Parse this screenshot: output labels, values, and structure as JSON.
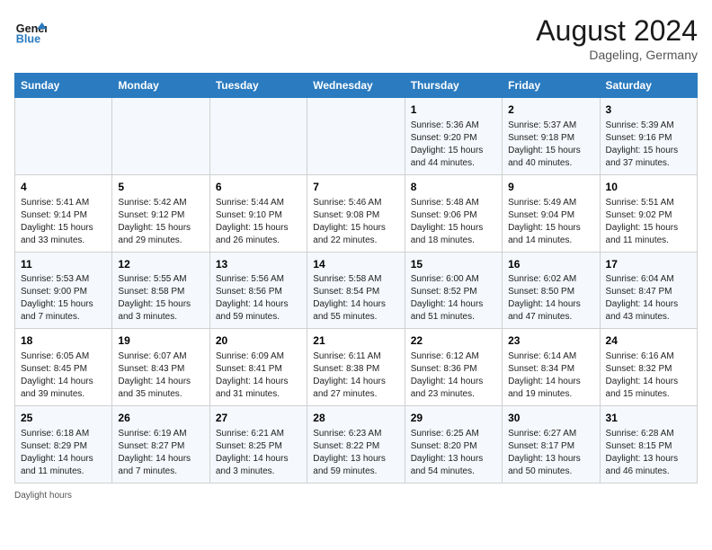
{
  "header": {
    "logo_line1": "General",
    "logo_line2": "Blue",
    "month_year": "August 2024",
    "location": "Dageling, Germany"
  },
  "days_of_week": [
    "Sunday",
    "Monday",
    "Tuesday",
    "Wednesday",
    "Thursday",
    "Friday",
    "Saturday"
  ],
  "weeks": [
    [
      {
        "day": "",
        "info": ""
      },
      {
        "day": "",
        "info": ""
      },
      {
        "day": "",
        "info": ""
      },
      {
        "day": "",
        "info": ""
      },
      {
        "day": "1",
        "info": "Sunrise: 5:36 AM\nSunset: 9:20 PM\nDaylight: 15 hours and 44 minutes."
      },
      {
        "day": "2",
        "info": "Sunrise: 5:37 AM\nSunset: 9:18 PM\nDaylight: 15 hours and 40 minutes."
      },
      {
        "day": "3",
        "info": "Sunrise: 5:39 AM\nSunset: 9:16 PM\nDaylight: 15 hours and 37 minutes."
      }
    ],
    [
      {
        "day": "4",
        "info": "Sunrise: 5:41 AM\nSunset: 9:14 PM\nDaylight: 15 hours and 33 minutes."
      },
      {
        "day": "5",
        "info": "Sunrise: 5:42 AM\nSunset: 9:12 PM\nDaylight: 15 hours and 29 minutes."
      },
      {
        "day": "6",
        "info": "Sunrise: 5:44 AM\nSunset: 9:10 PM\nDaylight: 15 hours and 26 minutes."
      },
      {
        "day": "7",
        "info": "Sunrise: 5:46 AM\nSunset: 9:08 PM\nDaylight: 15 hours and 22 minutes."
      },
      {
        "day": "8",
        "info": "Sunrise: 5:48 AM\nSunset: 9:06 PM\nDaylight: 15 hours and 18 minutes."
      },
      {
        "day": "9",
        "info": "Sunrise: 5:49 AM\nSunset: 9:04 PM\nDaylight: 15 hours and 14 minutes."
      },
      {
        "day": "10",
        "info": "Sunrise: 5:51 AM\nSunset: 9:02 PM\nDaylight: 15 hours and 11 minutes."
      }
    ],
    [
      {
        "day": "11",
        "info": "Sunrise: 5:53 AM\nSunset: 9:00 PM\nDaylight: 15 hours and 7 minutes."
      },
      {
        "day": "12",
        "info": "Sunrise: 5:55 AM\nSunset: 8:58 PM\nDaylight: 15 hours and 3 minutes."
      },
      {
        "day": "13",
        "info": "Sunrise: 5:56 AM\nSunset: 8:56 PM\nDaylight: 14 hours and 59 minutes."
      },
      {
        "day": "14",
        "info": "Sunrise: 5:58 AM\nSunset: 8:54 PM\nDaylight: 14 hours and 55 minutes."
      },
      {
        "day": "15",
        "info": "Sunrise: 6:00 AM\nSunset: 8:52 PM\nDaylight: 14 hours and 51 minutes."
      },
      {
        "day": "16",
        "info": "Sunrise: 6:02 AM\nSunset: 8:50 PM\nDaylight: 14 hours and 47 minutes."
      },
      {
        "day": "17",
        "info": "Sunrise: 6:04 AM\nSunset: 8:47 PM\nDaylight: 14 hours and 43 minutes."
      }
    ],
    [
      {
        "day": "18",
        "info": "Sunrise: 6:05 AM\nSunset: 8:45 PM\nDaylight: 14 hours and 39 minutes."
      },
      {
        "day": "19",
        "info": "Sunrise: 6:07 AM\nSunset: 8:43 PM\nDaylight: 14 hours and 35 minutes."
      },
      {
        "day": "20",
        "info": "Sunrise: 6:09 AM\nSunset: 8:41 PM\nDaylight: 14 hours and 31 minutes."
      },
      {
        "day": "21",
        "info": "Sunrise: 6:11 AM\nSunset: 8:38 PM\nDaylight: 14 hours and 27 minutes."
      },
      {
        "day": "22",
        "info": "Sunrise: 6:12 AM\nSunset: 8:36 PM\nDaylight: 14 hours and 23 minutes."
      },
      {
        "day": "23",
        "info": "Sunrise: 6:14 AM\nSunset: 8:34 PM\nDaylight: 14 hours and 19 minutes."
      },
      {
        "day": "24",
        "info": "Sunrise: 6:16 AM\nSunset: 8:32 PM\nDaylight: 14 hours and 15 minutes."
      }
    ],
    [
      {
        "day": "25",
        "info": "Sunrise: 6:18 AM\nSunset: 8:29 PM\nDaylight: 14 hours and 11 minutes."
      },
      {
        "day": "26",
        "info": "Sunrise: 6:19 AM\nSunset: 8:27 PM\nDaylight: 14 hours and 7 minutes."
      },
      {
        "day": "27",
        "info": "Sunrise: 6:21 AM\nSunset: 8:25 PM\nDaylight: 14 hours and 3 minutes."
      },
      {
        "day": "28",
        "info": "Sunrise: 6:23 AM\nSunset: 8:22 PM\nDaylight: 13 hours and 59 minutes."
      },
      {
        "day": "29",
        "info": "Sunrise: 6:25 AM\nSunset: 8:20 PM\nDaylight: 13 hours and 54 minutes."
      },
      {
        "day": "30",
        "info": "Sunrise: 6:27 AM\nSunset: 8:17 PM\nDaylight: 13 hours and 50 minutes."
      },
      {
        "day": "31",
        "info": "Sunrise: 6:28 AM\nSunset: 8:15 PM\nDaylight: 13 hours and 46 minutes."
      }
    ]
  ],
  "footer": {
    "daylight_label": "Daylight hours"
  }
}
